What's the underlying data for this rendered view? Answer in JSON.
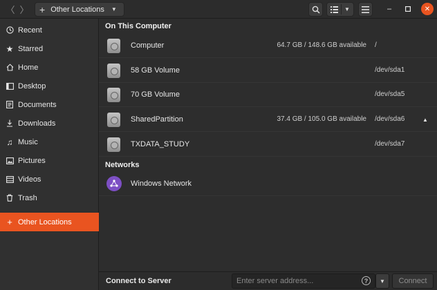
{
  "headerbar": {
    "path_label": "Other Locations",
    "back_icon": "chevron-left-icon",
    "forward_icon": "chevron-right-icon"
  },
  "sidebar": {
    "items": [
      {
        "label": "Recent",
        "icon": "clock-icon"
      },
      {
        "label": "Starred",
        "icon": "star-icon"
      },
      {
        "label": "Home",
        "icon": "home-icon"
      },
      {
        "label": "Desktop",
        "icon": "desktop-icon"
      },
      {
        "label": "Documents",
        "icon": "document-icon"
      },
      {
        "label": "Downloads",
        "icon": "download-icon"
      },
      {
        "label": "Music",
        "icon": "music-icon"
      },
      {
        "label": "Pictures",
        "icon": "picture-icon"
      },
      {
        "label": "Videos",
        "icon": "video-icon"
      },
      {
        "label": "Trash",
        "icon": "trash-icon"
      }
    ],
    "other_locations": {
      "label": "Other Locations",
      "icon": "plus-icon"
    }
  },
  "main": {
    "on_this_computer_title": "On This Computer",
    "drives": [
      {
        "name": "Computer",
        "space": "64.7 GB / 148.6 GB available",
        "device": "/"
      },
      {
        "name": "58 GB Volume",
        "space": "",
        "device": "/dev/sda1"
      },
      {
        "name": "70 GB Volume",
        "space": "",
        "device": "/dev/sda5"
      },
      {
        "name": "SharedPartition",
        "space": "37.4 GB / 105.0 GB available",
        "device": "/dev/sda6"
      },
      {
        "name": "TXDATA_STUDY",
        "space": "",
        "device": "/dev/sda7"
      }
    ],
    "networks_title": "Networks",
    "networks": [
      {
        "name": "Windows Network"
      }
    ]
  },
  "connect": {
    "label": "Connect to Server",
    "placeholder": "Enter server address...",
    "button_label": "Connect"
  },
  "colors": {
    "accent": "#e95420",
    "network_icon": "#7d4fc4"
  }
}
